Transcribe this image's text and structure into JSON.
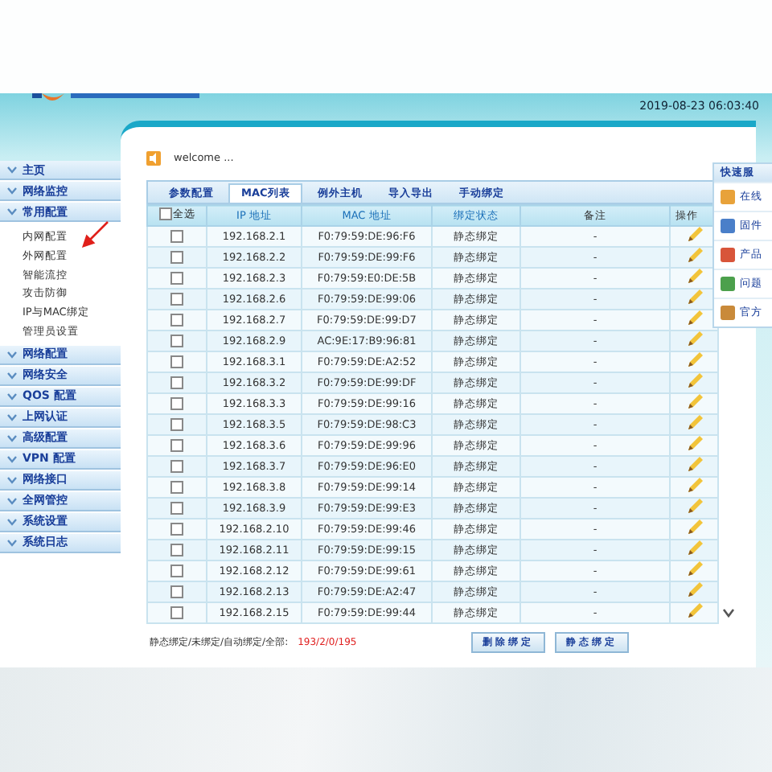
{
  "header": {
    "datetime": "2019-08-23 06:03:40"
  },
  "sidebar": {
    "items": [
      {
        "label": "主页"
      },
      {
        "label": "网络监控"
      },
      {
        "label": "常用配置",
        "children": [
          {
            "label": "内网配置"
          },
          {
            "label": "外网配置"
          },
          {
            "label": "智能流控"
          },
          {
            "label": "攻击防御"
          },
          {
            "label": "IP与MAC绑定"
          },
          {
            "label": "管理员设置"
          }
        ]
      },
      {
        "label": "网络配置"
      },
      {
        "label": "网络安全"
      },
      {
        "label": "QOS 配置"
      },
      {
        "label": "上网认证"
      },
      {
        "label": "高级配置"
      },
      {
        "label": "VPN 配置"
      },
      {
        "label": "网络接口"
      },
      {
        "label": "全网管控"
      },
      {
        "label": "系统设置"
      },
      {
        "label": "系统日志"
      }
    ]
  },
  "welcome": "welcome ...",
  "tabs": [
    {
      "label": "参数配置",
      "selected": false
    },
    {
      "label": "MAC列表",
      "selected": true
    },
    {
      "label": "例外主机",
      "selected": false
    },
    {
      "label": "导入导出",
      "selected": false
    },
    {
      "label": "手动绑定",
      "selected": false
    }
  ],
  "table": {
    "select_all": {
      "label": "全选",
      "checked": false
    },
    "columns": [
      "IP 地址",
      "MAC 地址",
      "绑定状态",
      "备注",
      "操作"
    ],
    "rows": [
      {
        "checked": false,
        "ip": "192.168.2.1",
        "mac": "F0:79:59:DE:96:F6",
        "status": "静态绑定",
        "note": "-"
      },
      {
        "checked": false,
        "ip": "192.168.2.2",
        "mac": "F0:79:59:DE:99:F6",
        "status": "静态绑定",
        "note": "-"
      },
      {
        "checked": false,
        "ip": "192.168.2.3",
        "mac": "F0:79:59:E0:DE:5B",
        "status": "静态绑定",
        "note": "-"
      },
      {
        "checked": false,
        "ip": "192.168.2.6",
        "mac": "F0:79:59:DE:99:06",
        "status": "静态绑定",
        "note": "-"
      },
      {
        "checked": false,
        "ip": "192.168.2.7",
        "mac": "F0:79:59:DE:99:D7",
        "status": "静态绑定",
        "note": "-"
      },
      {
        "checked": false,
        "ip": "192.168.2.9",
        "mac": "AC:9E:17:B9:96:81",
        "status": "静态绑定",
        "note": "-"
      },
      {
        "checked": false,
        "ip": "192.168.3.1",
        "mac": "F0:79:59:DE:A2:52",
        "status": "静态绑定",
        "note": "-"
      },
      {
        "checked": false,
        "ip": "192.168.3.2",
        "mac": "F0:79:59:DE:99:DF",
        "status": "静态绑定",
        "note": "-"
      },
      {
        "checked": false,
        "ip": "192.168.3.3",
        "mac": "F0:79:59:DE:99:16",
        "status": "静态绑定",
        "note": "-"
      },
      {
        "checked": false,
        "ip": "192.168.3.5",
        "mac": "F0:79:59:DE:98:C3",
        "status": "静态绑定",
        "note": "-"
      },
      {
        "checked": false,
        "ip": "192.168.3.6",
        "mac": "F0:79:59:DE:99:96",
        "status": "静态绑定",
        "note": "-"
      },
      {
        "checked": false,
        "ip": "192.168.3.7",
        "mac": "F0:79:59:DE:96:E0",
        "status": "静态绑定",
        "note": "-"
      },
      {
        "checked": false,
        "ip": "192.168.3.8",
        "mac": "F0:79:59:DE:99:14",
        "status": "静态绑定",
        "note": "-"
      },
      {
        "checked": false,
        "ip": "192.168.3.9",
        "mac": "F0:79:59:DE:99:E3",
        "status": "静态绑定",
        "note": "-"
      },
      {
        "checked": false,
        "ip": "192.168.2.10",
        "mac": "F0:79:59:DE:99:46",
        "status": "静态绑定",
        "note": "-"
      },
      {
        "checked": false,
        "ip": "192.168.2.11",
        "mac": "F0:79:59:DE:99:15",
        "status": "静态绑定",
        "note": "-"
      },
      {
        "checked": false,
        "ip": "192.168.2.12",
        "mac": "F0:79:59:DE:99:61",
        "status": "静态绑定",
        "note": "-"
      },
      {
        "checked": false,
        "ip": "192.168.2.13",
        "mac": "F0:79:59:DE:A2:47",
        "status": "静态绑定",
        "note": "-"
      },
      {
        "checked": false,
        "ip": "192.168.2.15",
        "mac": "F0:79:59:DE:99:44",
        "status": "静态绑定",
        "note": "-"
      }
    ]
  },
  "footer": {
    "summary_label": "静态绑定/未绑定/自动绑定/全部:",
    "summary_value": "193/2/0/195",
    "buttons": [
      "删除绑定",
      "静态绑定"
    ]
  },
  "quick_panel": {
    "title": "快速服",
    "items": [
      {
        "label": "在线"
      },
      {
        "label": "固件"
      },
      {
        "label": "产品"
      },
      {
        "label": "问题"
      },
      {
        "label": "官方"
      }
    ]
  }
}
